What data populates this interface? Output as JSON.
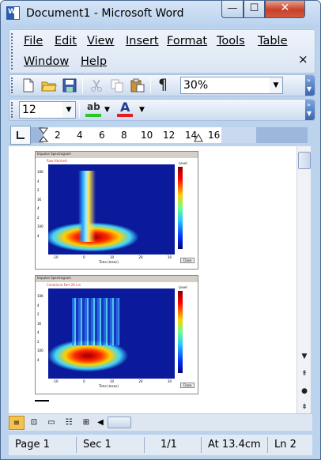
{
  "window": {
    "title": "Document1 - Microsoft Word",
    "app_icon_letter": "W"
  },
  "menu": {
    "items": [
      "File",
      "Edit",
      "View",
      "Insert",
      "Format",
      "Tools",
      "Table",
      "Window",
      "Help"
    ],
    "close_glyph": "×"
  },
  "standard_toolbar": {
    "zoom": "30%"
  },
  "formatting_toolbar": {
    "font_size": "12"
  },
  "ruler": {
    "ticks": [
      "2",
      "4",
      "6",
      "8",
      "10",
      "12",
      "14",
      "16"
    ]
  },
  "document": {
    "figures": [
      {
        "title": "Impulse Spectrogram",
        "subtitle": "Raw Harmed",
        "y_ticks": [
          "10K",
          "4",
          "2",
          "1K",
          "4",
          "2",
          "100",
          "4"
        ],
        "x_ticks": [
          "-10",
          "0",
          "10",
          "20",
          "30"
        ],
        "xlabel": "Time (msec)",
        "cbar_label": "Level",
        "button": "Close"
      },
      {
        "title": "Impulse Spectrogram",
        "subtitle": "Combined Part 26 Lm",
        "y_ticks": [
          "10K",
          "4",
          "2",
          "1K",
          "4",
          "2",
          "100",
          "4"
        ],
        "x_ticks": [
          "-10",
          "0",
          "10",
          "20",
          "30"
        ],
        "xlabel": "Time (msec)",
        "cbar_label": "Level",
        "button": "Close"
      }
    ]
  },
  "statusbar": {
    "page": "Page 1",
    "section": "Sec 1",
    "pages": "1/1",
    "at": "At 13.4cm",
    "line": "Ln 2"
  }
}
